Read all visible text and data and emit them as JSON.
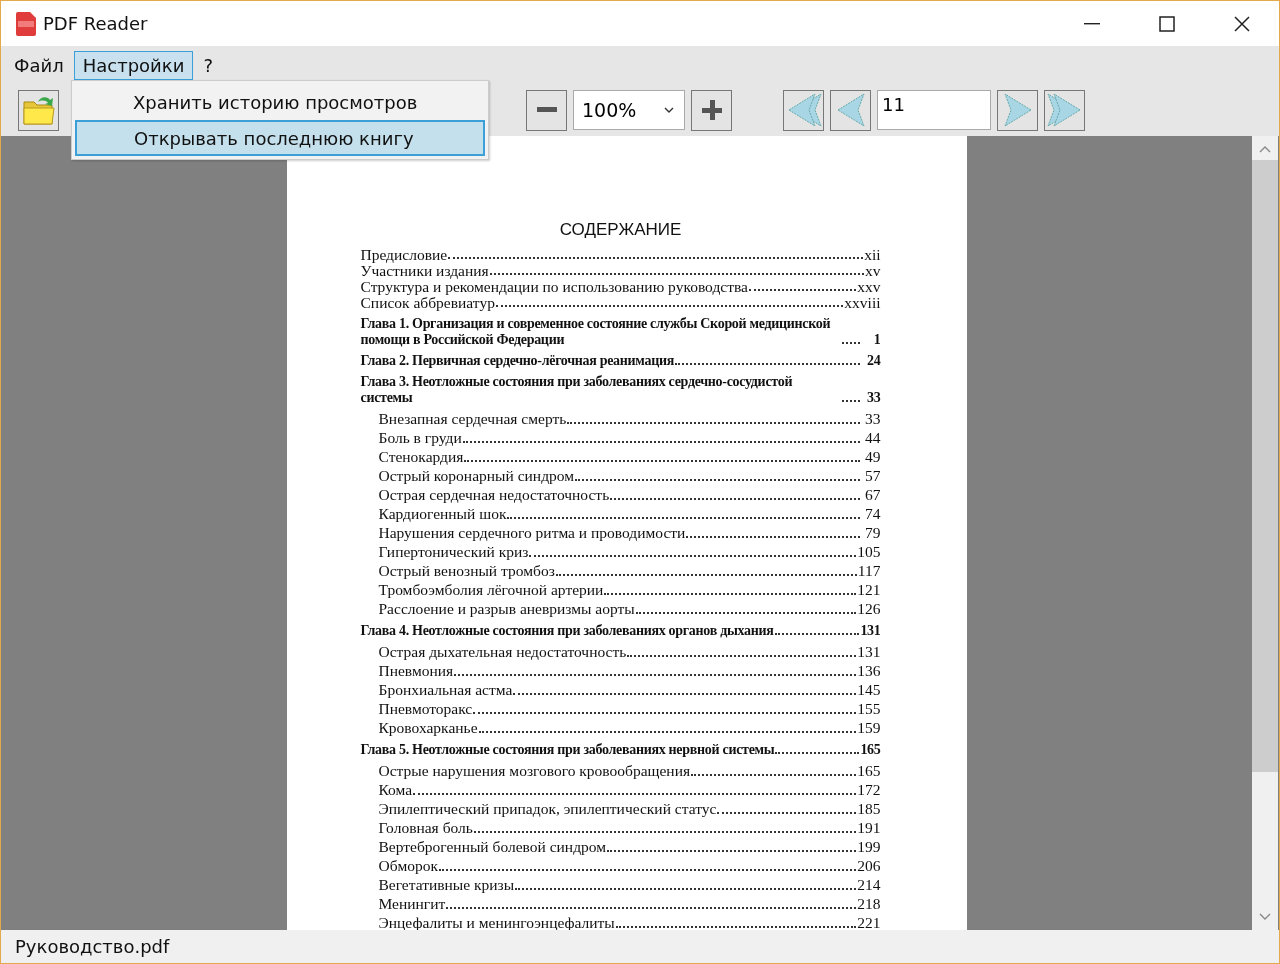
{
  "window": {
    "title": "PDF Reader"
  },
  "menu_bar": [
    {
      "label": "Файл",
      "selected": false
    },
    {
      "label": "Настройки",
      "selected": true
    },
    {
      "label": "?",
      "selected": false
    }
  ],
  "open_menu": {
    "items": [
      {
        "label": "Хранить историю просмотров",
        "selected": false
      },
      {
        "label": "Открывать последнюю книгу",
        "selected": true
      }
    ]
  },
  "toolbar": {
    "zoom": "100%",
    "page": "11"
  },
  "document": {
    "heading": "СОДЕРЖАНИЕ",
    "entries": [
      {
        "kind": "front",
        "text": "Предисловие",
        "page": "xii"
      },
      {
        "kind": "front",
        "text": "Участники издания",
        "page": "xv"
      },
      {
        "kind": "front",
        "text": "Структура и рекомендации по использованию руководства",
        "page": "xxv"
      },
      {
        "kind": "front",
        "text": "Список аббревиатур",
        "page": "xxviii"
      },
      {
        "kind": "chapter",
        "text": "Глава 1. Организация и современное состояние службы Скорой медицинской помощи в Российской Федерации",
        "page": "1"
      },
      {
        "kind": "chapter",
        "text": "Глава 2. Первичная сердечно-лёгочная реанимация",
        "page": "24"
      },
      {
        "kind": "chapter",
        "text": "Глава 3. Неотложные состояния при заболеваниях сердечно-сосудистой системы",
        "page": "33"
      },
      {
        "kind": "section",
        "text": "Внезапная сердечная смерть",
        "page": "33"
      },
      {
        "kind": "section",
        "text": "Боль в груди",
        "page": "44"
      },
      {
        "kind": "section",
        "text": "Стенокардия",
        "page": "49"
      },
      {
        "kind": "section",
        "text": "Острый коронарный синдром",
        "page": "57"
      },
      {
        "kind": "section",
        "text": "Острая сердечная недостаточность",
        "page": "67"
      },
      {
        "kind": "section",
        "text": "Кардиогенный шок",
        "page": "74"
      },
      {
        "kind": "section",
        "text": "Нарушения сердечного ритма и проводимости",
        "page": "79"
      },
      {
        "kind": "section",
        "text": "Гипертонический криз",
        "page": "105"
      },
      {
        "kind": "section",
        "text": "Острый венозный тромбоз",
        "page": "117"
      },
      {
        "kind": "section",
        "text": "Тромбоэмболия лёгочной артерии",
        "page": "121"
      },
      {
        "kind": "section",
        "text": "Расслоение и разрыв аневризмы аорты",
        "page": "126"
      },
      {
        "kind": "chapter",
        "text": "Глава 4. Неотложные состояния при заболеваниях органов дыхания",
        "page": "131"
      },
      {
        "kind": "section",
        "text": "Острая дыхательная недостаточность",
        "page": "131"
      },
      {
        "kind": "section",
        "text": "Пневмония",
        "page": "136"
      },
      {
        "kind": "section",
        "text": "Бронхиальная астма",
        "page": "145"
      },
      {
        "kind": "section",
        "text": "Пневмоторакс",
        "page": "155"
      },
      {
        "kind": "section",
        "text": "Кровохарканье",
        "page": "159"
      },
      {
        "kind": "chapter",
        "text": "Глава 5. Неотложные состояния при заболеваниях нервной системы",
        "page": "165"
      },
      {
        "kind": "section",
        "text": "Острые нарушения мозгового кровообращения",
        "page": "165"
      },
      {
        "kind": "section",
        "text": "Кома",
        "page": "172"
      },
      {
        "kind": "section",
        "text": "Эпилептический припадок, эпилептический статус",
        "page": "185"
      },
      {
        "kind": "section",
        "text": "Головная боль",
        "page": "191"
      },
      {
        "kind": "section",
        "text": "Вертеброгенный болевой синдром",
        "page": "199"
      },
      {
        "kind": "section",
        "text": "Обморок",
        "page": "206"
      },
      {
        "kind": "section",
        "text": "Вегетативные кризы",
        "page": "214"
      },
      {
        "kind": "section",
        "text": "Менингит",
        "page": "218"
      },
      {
        "kind": "section",
        "text": "Энцефалиты и менингоэнцефалиты",
        "page": "221"
      }
    ]
  },
  "status_bar": "Руководство.pdf"
}
